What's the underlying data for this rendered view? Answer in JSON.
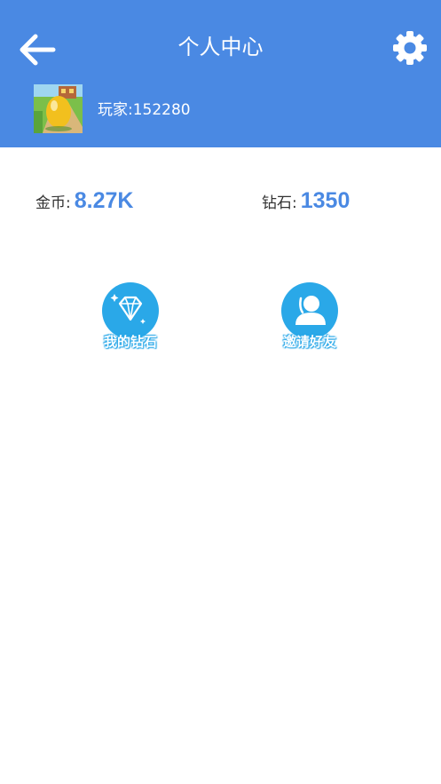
{
  "header": {
    "title": "个人中心",
    "back_icon": "arrow-left-icon",
    "settings_icon": "gear-icon",
    "background_color": "#4a89e3"
  },
  "profile": {
    "avatar_icon": "golden-egg-avatar",
    "player_name": "玩家:152280"
  },
  "stats": {
    "gold_label": "金币:",
    "gold_value": "8.27K",
    "diamond_label": "钻石:",
    "diamond_value": "1350",
    "value_color": "#4a89e3"
  },
  "actions": [
    {
      "label": "我的钻石",
      "icon": "diamond-icon"
    },
    {
      "label": "邀请好友",
      "icon": "user-icon"
    }
  ],
  "action_icon_color": "#2aa8e8"
}
